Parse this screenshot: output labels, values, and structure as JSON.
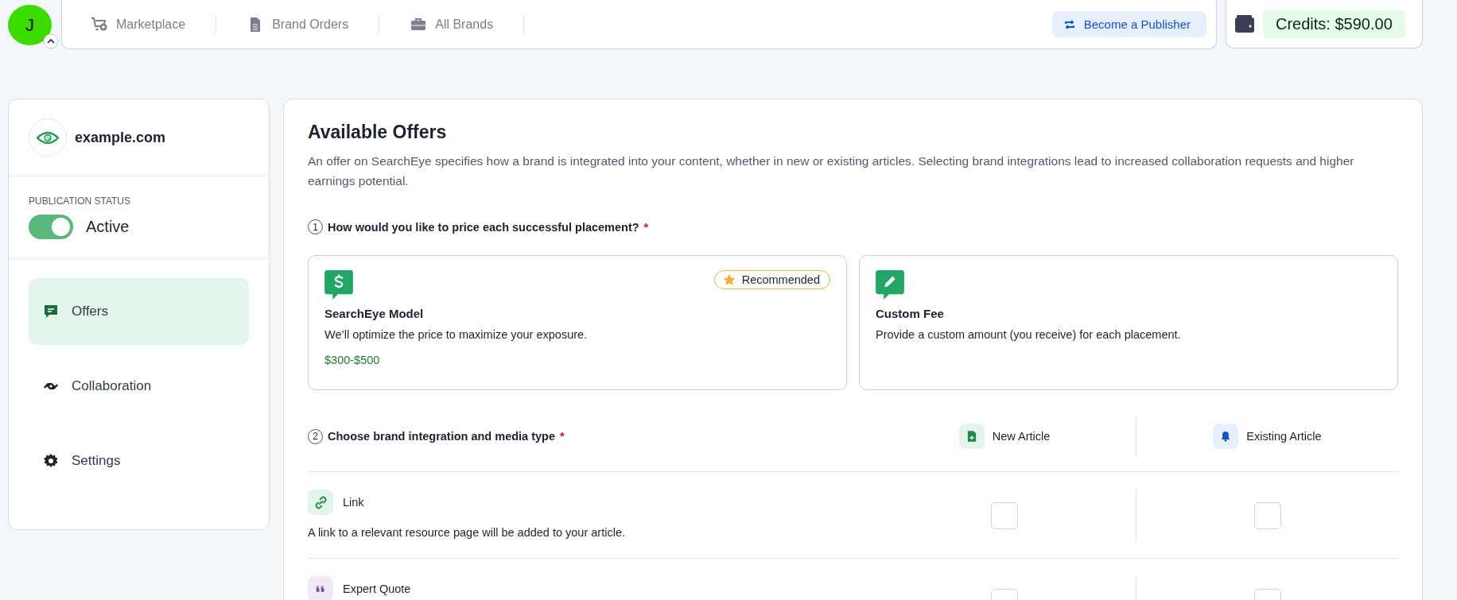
{
  "user": {
    "initial": "J"
  },
  "nav": {
    "items": [
      {
        "label": "Marketplace"
      },
      {
        "label": "Brand Orders"
      },
      {
        "label": "All Brands"
      }
    ],
    "publisher_button": "Become a Publisher"
  },
  "credits": "Credits: $590.00",
  "sidebar": {
    "site": "example.com",
    "status_label": "PUBLICATION STATUS",
    "status_on": true,
    "status_text": "Active",
    "items": [
      {
        "label": "Offers",
        "selected": true
      },
      {
        "label": "Collaboration",
        "selected": false
      },
      {
        "label": "Settings",
        "selected": false
      }
    ]
  },
  "offers": {
    "title": "Available Offers",
    "description": "An offer on SearchEye specifies how a brand is integrated into your content, whether in new or existing articles. Selecting brand integrations lead to increased collaboration requests and higher earnings potential.",
    "q1": {
      "number": "1",
      "text": "How would you like to price each successful placement?",
      "required_mark": "*"
    },
    "pricing_options": [
      {
        "title": "SearchEye Model",
        "description": "We’ll optimize the price to maximize your exposure.",
        "price": "$300-$500",
        "badge": "Recommended"
      },
      {
        "title": "Custom Fee",
        "description": "Provide a custom amount (you receive) for each placement."
      }
    ],
    "q2": {
      "number": "2",
      "text": "Choose brand integration and media type",
      "required_mark": "*"
    },
    "columns": [
      {
        "label": "New Article"
      },
      {
        "label": "Existing Article"
      }
    ],
    "integrations": [
      {
        "name": "Link",
        "description": "A link to a relevant resource page will be added to your article.",
        "options": [
          {
            "checked": false
          },
          {
            "checked": false
          }
        ]
      },
      {
        "name": "Expert Quote",
        "options": [
          {
            "checked": false
          },
          {
            "checked": false
          }
        ]
      }
    ]
  }
}
